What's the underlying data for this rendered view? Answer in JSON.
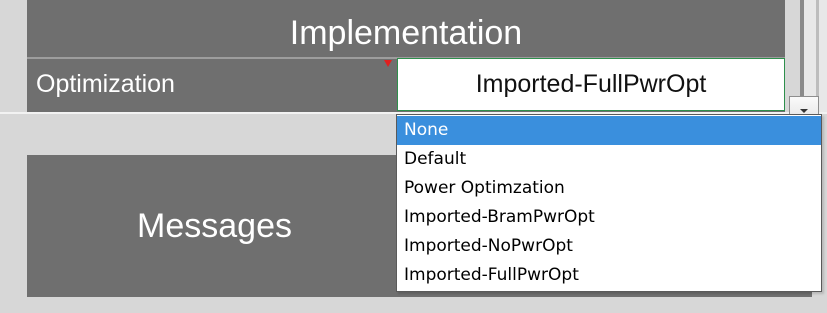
{
  "implementation": {
    "title": "Implementation",
    "optimization_label": "Optimization",
    "selected_value": "Imported-FullPwrOpt"
  },
  "dropdown": {
    "options": [
      {
        "label": "None",
        "highlighted": true
      },
      {
        "label": "Default",
        "highlighted": false
      },
      {
        "label": "Power Optimzation",
        "highlighted": false
      },
      {
        "label": "Imported-BramPwrOpt",
        "highlighted": false
      },
      {
        "label": "Imported-NoPwrOpt",
        "highlighted": false
      },
      {
        "label": "Imported-FullPwrOpt",
        "highlighted": false
      }
    ]
  },
  "messages": {
    "label": "Messages"
  },
  "colors": {
    "panel": "#6f6f6f",
    "highlight": "#3a8fdd",
    "marker": "#e02020",
    "cell_border": "#2e8f4c"
  },
  "icons": {
    "dropdown_arrow": "chevron-down-icon",
    "comment_marker": "comment-indicator-icon"
  }
}
